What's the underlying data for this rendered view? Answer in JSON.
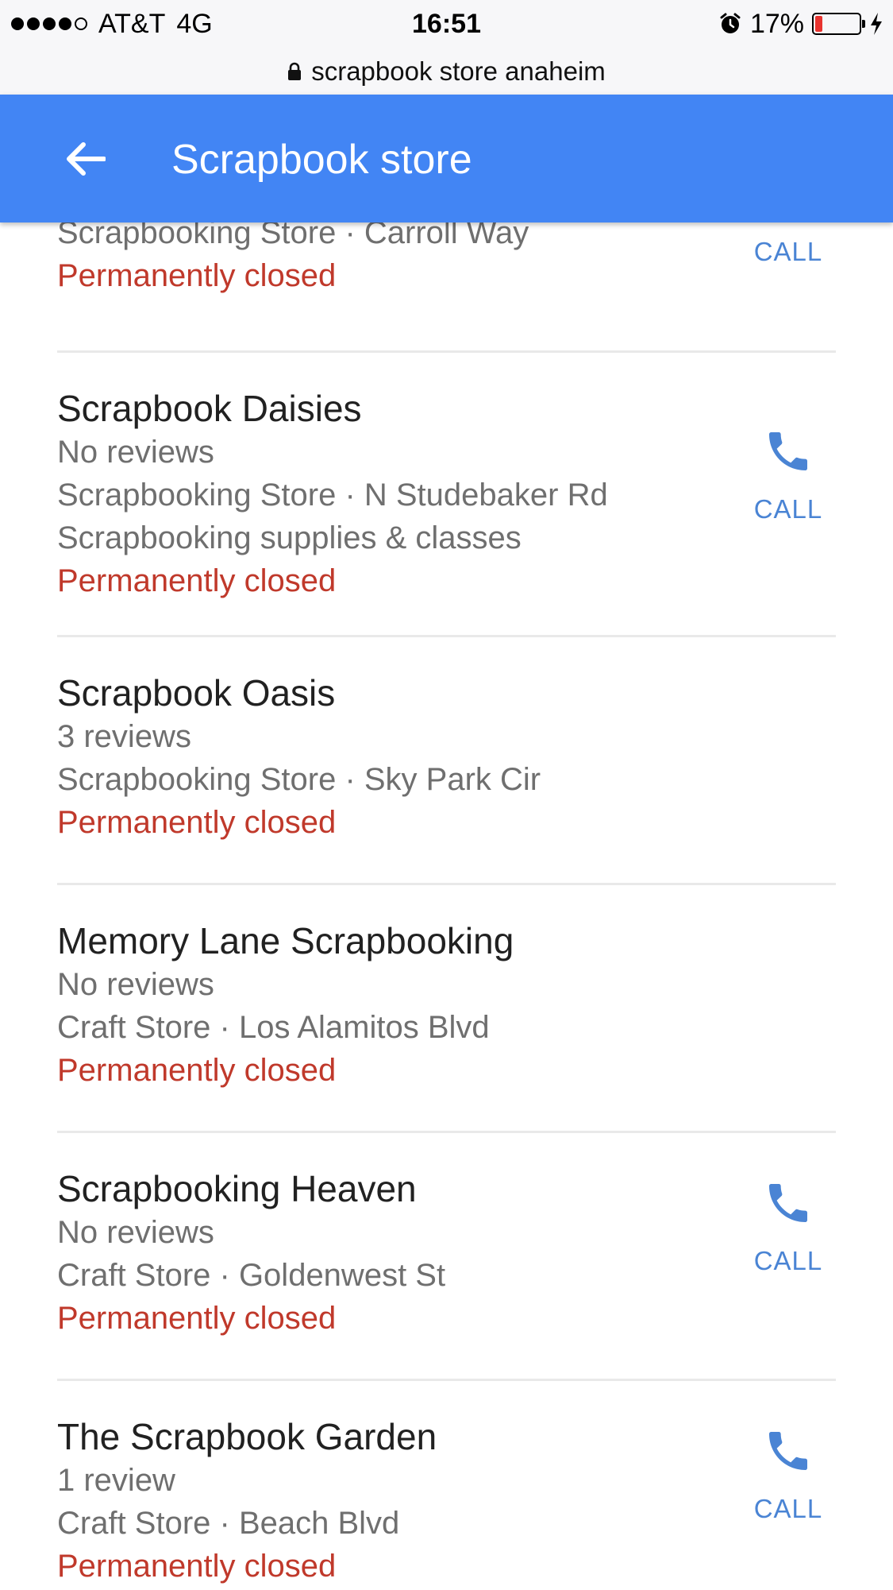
{
  "status_bar": {
    "carrier": "AT&T",
    "network": "4G",
    "time": "16:51",
    "battery_text": "17%",
    "battery_level": 0.17,
    "battery_color": "#e8332f",
    "signal_bars_filled": 4,
    "signal_bars_total": 5
  },
  "address_bar": {
    "url_text": "scrapbook store anaheim",
    "lock_icon": "lock-icon"
  },
  "app_bar": {
    "title": "Scrapbook store",
    "back_icon": "arrow-left-icon",
    "color": "#4285f4"
  },
  "results": [
    {
      "name": "",
      "lines": [
        "Scrapbooking Store · Carroll Way"
      ],
      "status": "Permanently closed",
      "call": true,
      "call_label": "CALL",
      "call_icon_visible": false
    },
    {
      "name": "Scrapbook Daisies",
      "lines": [
        "No reviews",
        "Scrapbooking Store · N Studebaker Rd",
        "Scrapbooking supplies & classes"
      ],
      "status": "Permanently closed",
      "call": true,
      "call_label": "CALL",
      "call_icon_visible": true
    },
    {
      "name": "Scrapbook Oasis",
      "lines": [
        "3 reviews",
        "Scrapbooking Store · Sky Park Cir"
      ],
      "status": "Permanently closed",
      "call": false
    },
    {
      "name": "Memory Lane Scrapbooking",
      "lines": [
        "No reviews",
        "Craft Store · Los Alamitos Blvd"
      ],
      "status": "Permanently closed",
      "call": false
    },
    {
      "name": "Scrapbooking Heaven",
      "lines": [
        "No reviews",
        "Craft Store · Goldenwest St"
      ],
      "status": "Permanently closed",
      "call": true,
      "call_label": "CALL",
      "call_icon_visible": true
    },
    {
      "name": "The Scrapbook Garden",
      "lines": [
        "1 review",
        "Craft Store · Beach Blvd"
      ],
      "status": "Permanently closed",
      "call": true,
      "call_label": "CALL",
      "call_icon_visible": true
    }
  ],
  "colors": {
    "closed_status": "#c0392b",
    "call_accent": "#4a84d4",
    "secondary_text": "#6f6f6f"
  }
}
